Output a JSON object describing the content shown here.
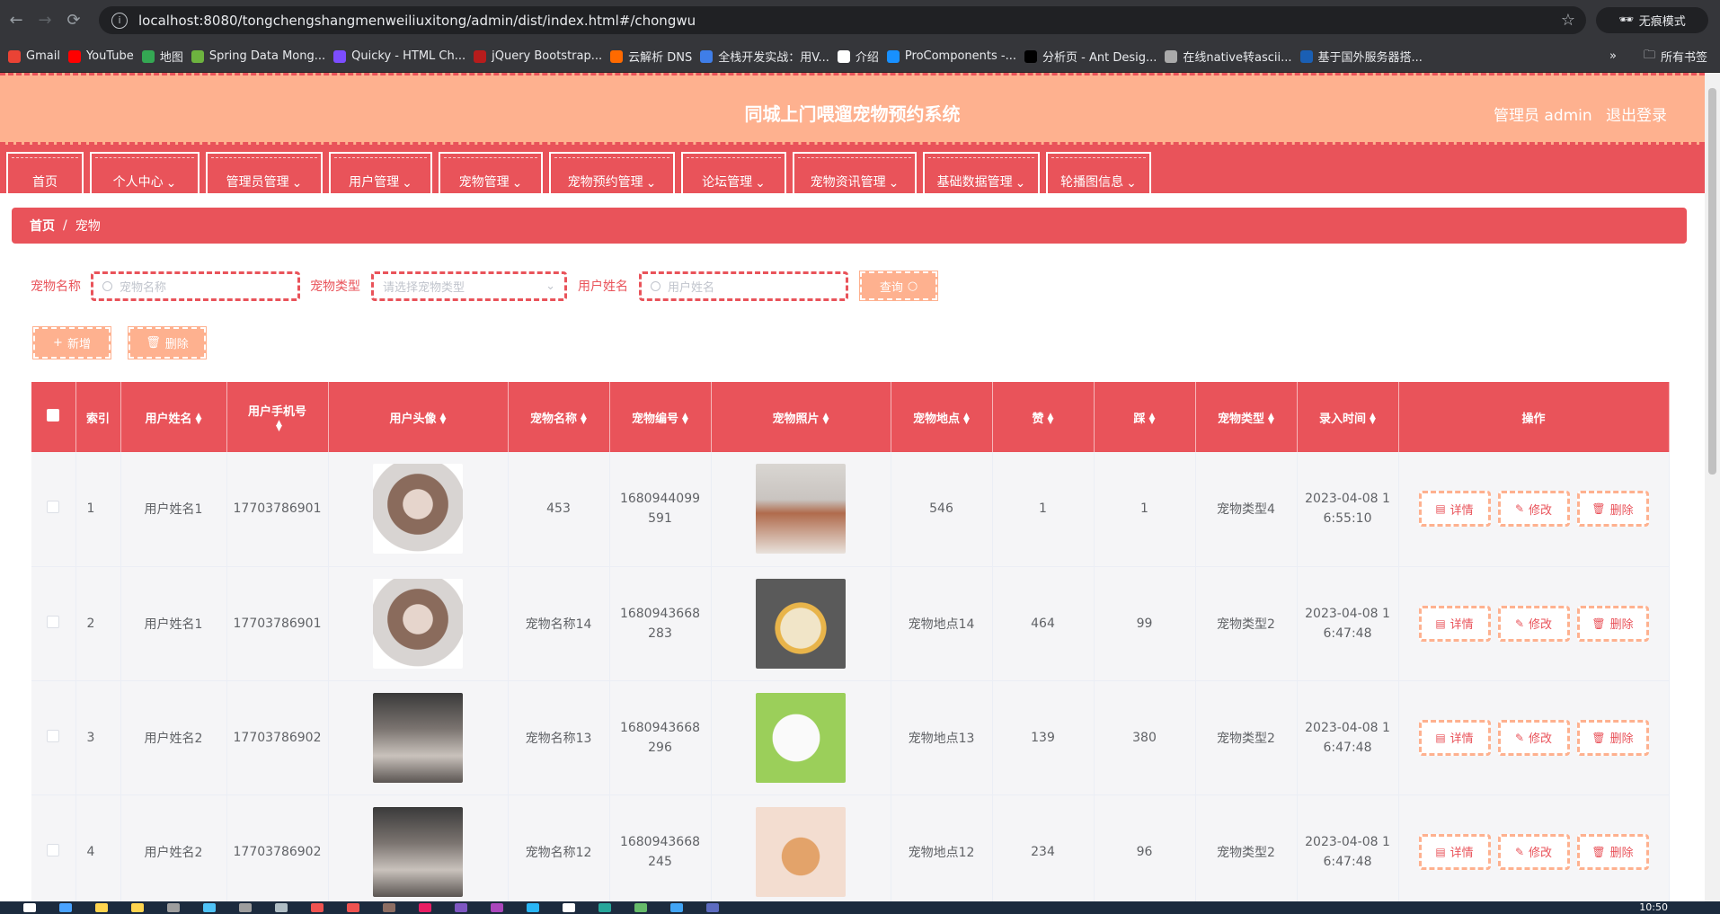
{
  "browser": {
    "url": "localhost:8080/tongchengshangmenweiliuxitong/admin/dist/index.html#/chongwu",
    "incognito_label": "无痕模式",
    "all_bookmarks_label": "所有书签",
    "bookmarks": [
      {
        "label": "Gmail",
        "color": "#ea4335"
      },
      {
        "label": "YouTube",
        "color": "#ff0000"
      },
      {
        "label": "地图",
        "color": "#34a853"
      },
      {
        "label": "Spring Data Mong...",
        "color": "#6db33f"
      },
      {
        "label": "Quicky - HTML Ch...",
        "color": "#7c4dff"
      },
      {
        "label": "jQuery Bootstrap...",
        "color": "#b71c1c"
      },
      {
        "label": "云解析 DNS",
        "color": "#ff6a00"
      },
      {
        "label": "全栈开发实战：用V...",
        "color": "#3f7ee8"
      },
      {
        "label": "介绍",
        "color": "#ffffff"
      },
      {
        "label": "ProComponents -...",
        "color": "#1890ff"
      },
      {
        "label": "分析页 - Ant Desig...",
        "color": "#000000"
      },
      {
        "label": "在线native转ascii...",
        "color": "#aaaaaa"
      },
      {
        "label": "基于国外服务器搭...",
        "color": "#1a5fb4"
      }
    ]
  },
  "header": {
    "title": "同城上门喂遛宠物预约系统",
    "user": "管理员 admin",
    "logout": "退出登录"
  },
  "menu": [
    {
      "label": "首页",
      "dropdown": false
    },
    {
      "label": "个人中心",
      "dropdown": true
    },
    {
      "label": "管理员管理",
      "dropdown": true
    },
    {
      "label": "用户管理",
      "dropdown": true
    },
    {
      "label": "宠物管理",
      "dropdown": true
    },
    {
      "label": "宠物预约管理",
      "dropdown": true
    },
    {
      "label": "论坛管理",
      "dropdown": true
    },
    {
      "label": "宠物资讯管理",
      "dropdown": true
    },
    {
      "label": "基础数据管理",
      "dropdown": true
    },
    {
      "label": "轮播图信息",
      "dropdown": true
    }
  ],
  "breadcrumb": {
    "home": "首页",
    "separator": "/",
    "current": "宠物"
  },
  "search": {
    "pet_name_label": "宠物名称",
    "pet_name_placeholder": "宠物名称",
    "pet_type_label": "宠物类型",
    "pet_type_placeholder": "请选择宠物类型",
    "user_name_label": "用户姓名",
    "user_name_placeholder": "用户姓名",
    "query_button": "查询"
  },
  "actions": {
    "add": "新增",
    "delete": "删除"
  },
  "table": {
    "headers": [
      "索引",
      "用户姓名",
      "用户手机号",
      "用户头像",
      "宠物名称",
      "宠物编号",
      "宠物照片",
      "宠物地点",
      "赞",
      "踩",
      "宠物类型",
      "录入时间",
      "操作"
    ],
    "ops": {
      "detail": "详情",
      "edit": "修改",
      "delete": "删除"
    },
    "rows": [
      {
        "index": "1",
        "user_name": "用户姓名1",
        "phone": "17703786901",
        "avatar": "avatar-female",
        "pet_name": "453",
        "pet_no": "1680944099591",
        "photo": "pet-photo-1",
        "location": "546",
        "likes": "1",
        "dislikes": "1",
        "pet_type": "宠物类型4",
        "created": "2023-04-08 16:55:10"
      },
      {
        "index": "2",
        "user_name": "用户姓名1",
        "phone": "17703786901",
        "avatar": "avatar-female",
        "pet_name": "宠物名称14",
        "pet_no": "1680943668283",
        "photo": "pet-photo-2",
        "location": "宠物地点14",
        "likes": "464",
        "dislikes": "99",
        "pet_type": "宠物类型2",
        "created": "2023-04-08 16:47:48"
      },
      {
        "index": "3",
        "user_name": "用户姓名2",
        "phone": "17703786902",
        "avatar": "avatar-male",
        "pet_name": "宠物名称13",
        "pet_no": "1680943668296",
        "photo": "pet-photo-3",
        "location": "宠物地点13",
        "likes": "139",
        "dislikes": "380",
        "pet_type": "宠物类型2",
        "created": "2023-04-08 16:47:48"
      },
      {
        "index": "4",
        "user_name": "用户姓名2",
        "phone": "17703786902",
        "avatar": "avatar-male",
        "pet_name": "宠物名称12",
        "pet_no": "1680943668245",
        "photo": "pet-photo-4",
        "location": "宠物地点12",
        "likes": "234",
        "dislikes": "96",
        "pet_type": "宠物类型2",
        "created": "2023-04-08 16:47:48"
      }
    ]
  },
  "taskbar": {
    "time": "10:50"
  },
  "colors": {
    "primary": "#e9535a",
    "accent": "#feb18f"
  }
}
